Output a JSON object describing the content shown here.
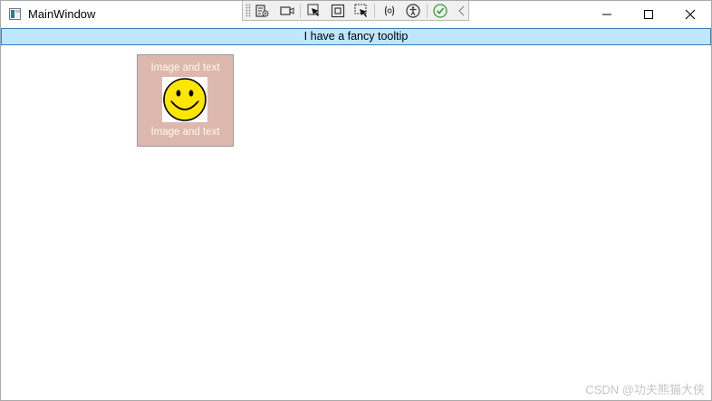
{
  "window": {
    "title": "MainWindow"
  },
  "dev_toolbar": {
    "icons": [
      "live-visual-tree-icon",
      "record-icon",
      "select-element-icon",
      "display-adorners-icon",
      "track-focus-icon",
      "binding-failures-icon",
      "accessibility-icon",
      "hot-reload-ok-icon",
      "collapse-toolbar-icon"
    ]
  },
  "window_controls": [
    "minimize-icon",
    "maximize-icon",
    "close-icon"
  ],
  "tooltip_bar": {
    "text": "I have a fancy tooltip",
    "background": "#bee6fd",
    "border": "#3c7fb1"
  },
  "card": {
    "top_text": "Image and text",
    "bottom_text": "Image and text",
    "background": "#ddb8ae",
    "image": "smiley-face-icon"
  },
  "watermark": "CSDN @功夫熊猫大侠"
}
